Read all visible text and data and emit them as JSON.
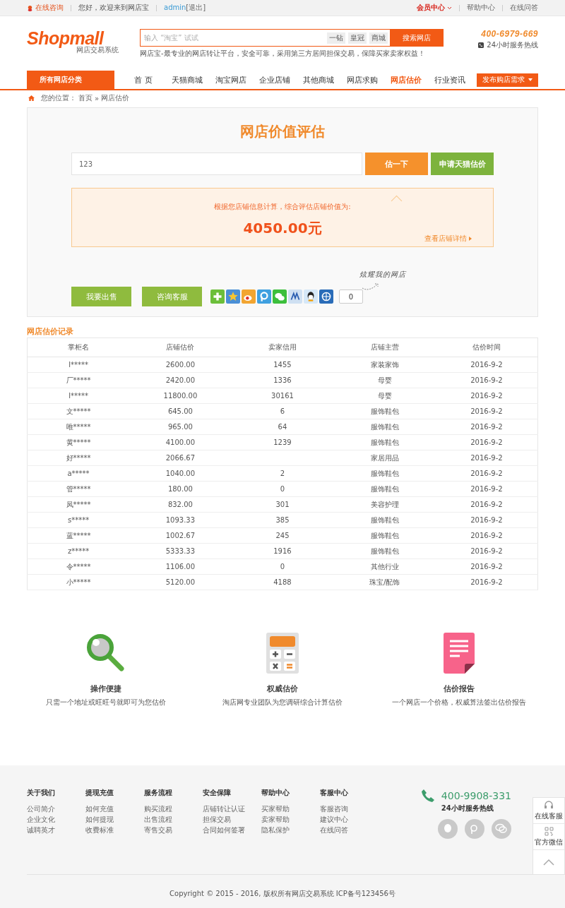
{
  "top_bar": {
    "consult": "在线咨询",
    "welcome": "您好，欢迎来到网店宝",
    "user": "admin",
    "logout": "[退出]",
    "links": [
      {
        "label": "会员中心",
        "kind": "menu"
      },
      {
        "label": "帮助中心",
        "kind": "link"
      },
      {
        "label": "在线问答",
        "kind": "link"
      }
    ]
  },
  "header": {
    "logo": "Shopmall",
    "logo_sub": "网店交易系统",
    "search": {
      "placeholder": "输入 “淘宝” 试试",
      "tags": [
        "一钻",
        "皇冠",
        "商城"
      ],
      "button": "搜索网店"
    },
    "slogan": "网店宝-最专业的网店转让平台，安全可靠，采用第三方居间担保交易，保障买家卖家权益！",
    "phone": "400-6979-669",
    "phone_note": "24小时服务热线"
  },
  "nav": {
    "category": "所有网店分类",
    "items": [
      {
        "label": "首 页",
        "selected": false
      },
      {
        "label": "天猫商城",
        "selected": false
      },
      {
        "label": "淘宝网店",
        "selected": false
      },
      {
        "label": "企业店铺",
        "selected": false
      },
      {
        "label": "其他商城",
        "selected": false
      },
      {
        "label": "网店求购",
        "selected": false
      },
      {
        "label": "网店估价",
        "selected": true
      },
      {
        "label": "行业资讯",
        "selected": false
      }
    ],
    "publish": "发布购店需求"
  },
  "breadcrumb": [
    "您的位置：",
    "首页",
    "»",
    "网店估价"
  ],
  "evaluation": {
    "title": "网店价值评估",
    "input_value": "123",
    "buttons": [
      "估一下",
      "申请天猫估价"
    ],
    "result_label": "根据您店铺信息计算，综合评估店铺价值为:",
    "result_value": "4050.00元",
    "details_link": "查看店铺详情",
    "actions": [
      "我要出售",
      "咨询客服"
    ],
    "share_count": "0",
    "share_note": "炫耀我的网店"
  },
  "records": {
    "title": "网店估价记录",
    "columns": [
      "掌柜名",
      "店铺估价",
      "卖家信用",
      "店铺主营",
      "估价时间"
    ],
    "rows": [
      [
        "l*****",
        "2600.00",
        "1455",
        "家装家饰",
        "2016-9-2"
      ],
      [
        "厂*****",
        "2420.00",
        "1336",
        "母婴",
        "2016-9-2"
      ],
      [
        "l*****",
        "11800.00",
        "30161",
        "母婴",
        "2016-9-2"
      ],
      [
        "文*****",
        "645.00",
        "6",
        "服饰鞋包",
        "2016-9-2"
      ],
      [
        "唯*****",
        "965.00",
        "64",
        "服饰鞋包",
        "2016-9-2"
      ],
      [
        "黄*****",
        "4100.00",
        "1239",
        "服饰鞋包",
        "2016-9-2"
      ],
      [
        "好*****",
        "2066.67",
        "",
        "家居用品",
        "2016-9-2"
      ],
      [
        "a*****",
        "1040.00",
        "2",
        "服饰鞋包",
        "2016-9-2"
      ],
      [
        "管*****",
        "180.00",
        "0",
        "服饰鞋包",
        "2016-9-2"
      ],
      [
        "凤*****",
        "832.00",
        "301",
        "美容护理",
        "2016-9-2"
      ],
      [
        "s*****",
        "1093.33",
        "385",
        "服饰鞋包",
        "2016-9-2"
      ],
      [
        "蓝*****",
        "1002.67",
        "245",
        "服饰鞋包",
        "2016-9-2"
      ],
      [
        "z*****",
        "5333.33",
        "1916",
        "服饰鞋包",
        "2016-9-2"
      ],
      [
        "令*****",
        "1106.00",
        "0",
        "其他行业",
        "2016-9-2"
      ],
      [
        "小*****",
        "5120.00",
        "4188",
        "珠宝/配饰",
        "2016-9-2"
      ]
    ]
  },
  "features": [
    {
      "kind": "search",
      "title": "操作便捷",
      "text": "只需一个地址或旺旺号就即可为您估价"
    },
    {
      "kind": "calculator",
      "title": "权威估价",
      "text": "淘店网专业团队为您调研综合计算估价"
    },
    {
      "kind": "report",
      "title": "估价报告",
      "text": "一个网店一个价格，权威算法签出估价报告"
    }
  ],
  "footer": {
    "columns": [
      {
        "title": "关于我们",
        "links": [
          "公司简介",
          "企业文化",
          "诚聘英才"
        ]
      },
      {
        "title": "提现充值",
        "links": [
          "如何充值",
          "如何提现",
          "收费标准"
        ]
      },
      {
        "title": "服务流程",
        "links": [
          "购买流程",
          "出售流程",
          "寄售交易"
        ]
      },
      {
        "title": "安全保障",
        "links": [
          "店铺转让认证",
          "担保交易",
          "合同如何签署"
        ]
      },
      {
        "title": "帮助中心",
        "links": [
          "买家帮助",
          "卖家帮助",
          "隐私保护"
        ]
      },
      {
        "title": "客服中心",
        "links": [
          "客服咨询",
          "建议中心",
          "在线问答"
        ]
      }
    ],
    "phone": "400-9908-331",
    "phone_note": "24小时服务热线",
    "copyright": "Copyright © 2015 - 2016, 版权所有网店交易系统 ICP备号123456号"
  },
  "side_float": [
    "在线客服",
    "官方微信"
  ]
}
